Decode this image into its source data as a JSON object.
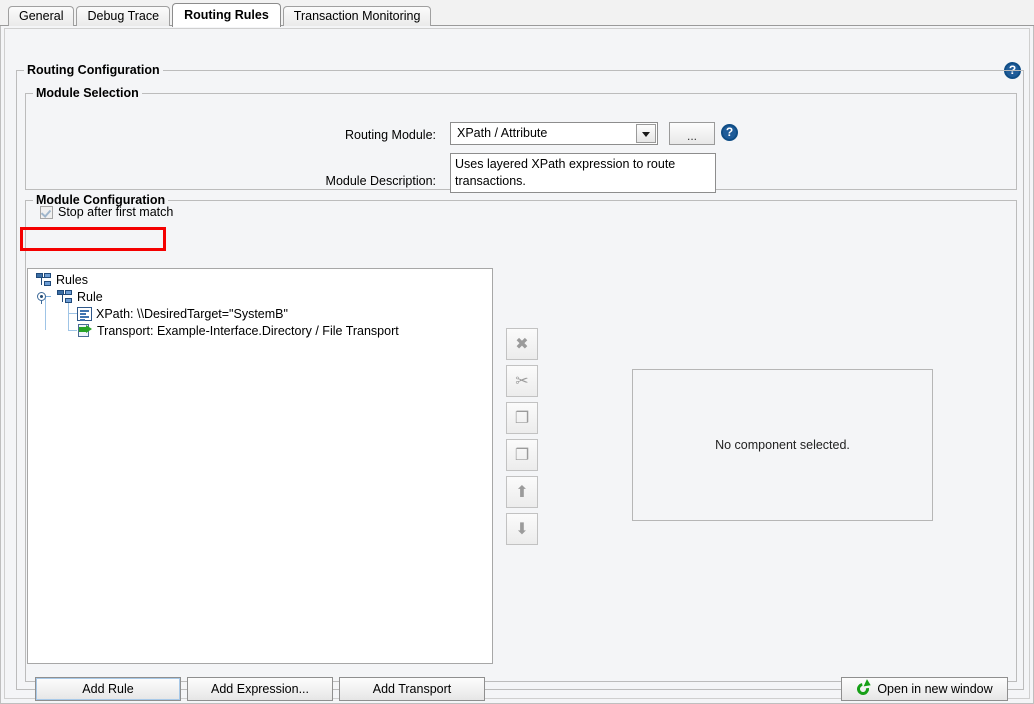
{
  "tabs": [
    {
      "label": "General",
      "active": false
    },
    {
      "label": "Debug Trace",
      "active": false
    },
    {
      "label": "Routing Rules",
      "active": true
    },
    {
      "label": "Transaction Monitoring",
      "active": false
    }
  ],
  "help_icon": "help-icon",
  "groups": {
    "routing_configuration": "Routing Configuration",
    "module_selection": "Module Selection",
    "module_configuration": "Module Configuration"
  },
  "module_selection": {
    "routing_module_label": "Routing Module:",
    "routing_module_value": "XPath / Attribute",
    "browse_button_label": "...",
    "module_description_label": "Module Description:",
    "module_description_value": "Uses layered XPath expression to route transactions."
  },
  "module_configuration": {
    "stop_after_first_match_label": "Stop after first match",
    "stop_after_first_match_checked": true,
    "annotation_color": "#f40000"
  },
  "tree": {
    "nodes": [
      {
        "label": "Rules",
        "icon": "hierarchy-icon",
        "depth": 0
      },
      {
        "label": "Rule",
        "icon": "hierarchy-icon",
        "depth": 1
      },
      {
        "label": "XPath: \\\\DesiredTarget=\"SystemB\"",
        "icon": "xpath-icon",
        "depth": 2
      },
      {
        "label": "Transport: Example-Interface.Directory / File Transport",
        "icon": "transport-icon",
        "depth": 2
      }
    ]
  },
  "toolbar": {
    "buttons": [
      {
        "name": "delete-button",
        "glyph": "✖",
        "enabled": false
      },
      {
        "name": "cut-button",
        "glyph": "✂",
        "enabled": false
      },
      {
        "name": "copy-button",
        "glyph": "❐",
        "enabled": false
      },
      {
        "name": "paste-button",
        "glyph": "❐",
        "enabled": false
      },
      {
        "name": "move-up-button",
        "glyph": "⬆",
        "enabled": false
      },
      {
        "name": "move-down-button",
        "glyph": "⬇",
        "enabled": false
      }
    ]
  },
  "preview": {
    "empty_text": "No component selected."
  },
  "bottom_buttons": {
    "add_rule": "Add Rule",
    "add_expression": "Add Expression...",
    "add_transport": "Add Transport",
    "open_in_new_window": "Open in new window"
  }
}
